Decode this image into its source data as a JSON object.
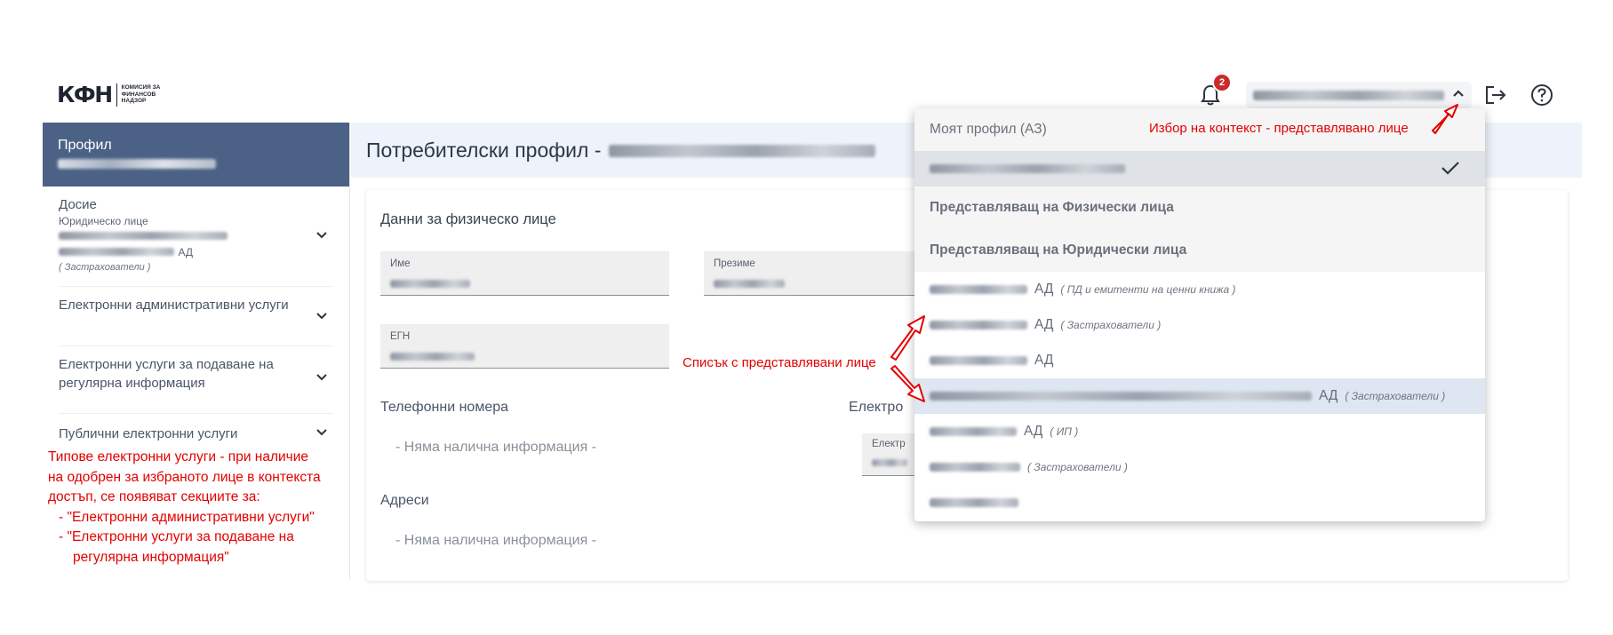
{
  "header": {
    "logo_mark": "КФН",
    "logo_text_1": "КОМИСИЯ ЗА",
    "logo_text_2": "ФИНАНСОВ",
    "logo_text_3": "НАДЗОР",
    "notification_count": "2",
    "icons": [
      "bell-icon",
      "chevron-up-icon",
      "logout-icon",
      "help-icon"
    ]
  },
  "sidebar": {
    "profile_label": "Профил",
    "items": [
      {
        "label": "Досие",
        "sub": "Юридическо лице",
        "suffix": "АД",
        "category": "( Застрахователи )"
      },
      {
        "label": "Електронни административни услуги"
      },
      {
        "label": "Електронни услуги за подаване на регулярна информация"
      },
      {
        "label": "Публични електронни услуги"
      }
    ]
  },
  "main": {
    "page_title": "Потребителски профил -",
    "card_title": "Данни за физическо лице",
    "fields": {
      "name": "Име",
      "middle_name": "Презиме",
      "egn": "ЕГН",
      "email_short": "Електр"
    },
    "phones_title": "Телефонни номера",
    "emails_title": "Електро",
    "addresses_title": "Адреси",
    "no_info": "- Няма налична информация -"
  },
  "dropdown": {
    "my_profile": "Моят профил (АЗ)",
    "rep_physical": "Представляващ на Физически лица",
    "rep_legal": "Представляващ на Юридически лица",
    "entries": [
      {
        "suffix": "АД",
        "tag": "( ПД и емитенти на ценни книжа )"
      },
      {
        "suffix": "АД",
        "tag": "( Застрахователи )"
      },
      {
        "suffix": "АД",
        "tag": ""
      },
      {
        "suffix": "АД",
        "tag": "( Застрахователи )"
      },
      {
        "suffix": "АД",
        "tag": "( ИП )"
      },
      {
        "suffix": "",
        "tag": "( Застрахователи )"
      },
      {
        "suffix": "",
        "tag": ""
      }
    ]
  },
  "annotations": {
    "context": "Избор на контекст - представлявано лице",
    "list": "Списък с представлявани лице",
    "left_1": "Типове електронни услуги - при наличие",
    "left_2": "на одобрен за избраното лице в контекста",
    "left_3": "достъп, се появяват секциите за:",
    "left_4": "- \"Електронни административни услуги\"",
    "left_5": "- \"Електронни услуги за подаване на",
    "left_6": "регулярна информация\""
  },
  "colors": {
    "sidebar_active": "#4b6286",
    "annotation": "#e40000",
    "badge": "#cc2a2a",
    "title_bar": "#eef3fb"
  }
}
